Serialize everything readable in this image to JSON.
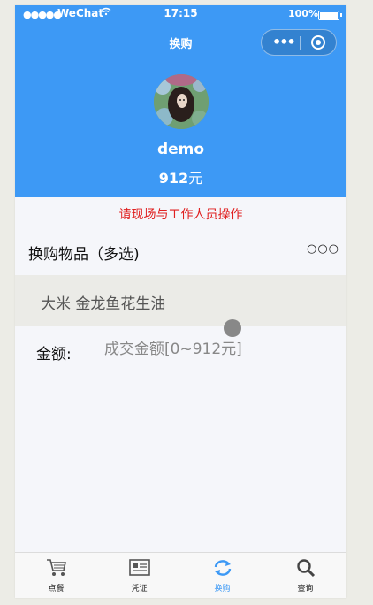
{
  "status_bar": {
    "signal": "●●●●●",
    "carrier": "WeChat",
    "time": "17:15",
    "battery_percent": "100%"
  },
  "nav": {
    "title": "换购",
    "more_icon": "more-dots-icon",
    "close_icon": "target-circle-icon"
  },
  "profile": {
    "username": "demo",
    "balance_value": "912",
    "balance_unit": "元"
  },
  "notice": "请现场与工作人员操作",
  "section": {
    "title": "换购物品（多选)",
    "more_label": "○○○"
  },
  "items": {
    "selected_text": "大米  金龙鱼花生油"
  },
  "amount": {
    "label": "金额:",
    "placeholder": "成交金额[0~912元]",
    "value": ""
  },
  "tabbar": {
    "active_color": "#3d99f5",
    "tabs": [
      {
        "label": "点餐",
        "icon": "shopping-cart-icon"
      },
      {
        "label": "凭证",
        "icon": "voucher-icon"
      },
      {
        "label": "换购",
        "icon": "exchange-refresh-icon"
      },
      {
        "label": "查询",
        "icon": "search-icon"
      }
    ]
  },
  "colors": {
    "header_bg": "#3d99f5",
    "notice_text": "#e02020",
    "page_bg": "#f5f6fa"
  }
}
